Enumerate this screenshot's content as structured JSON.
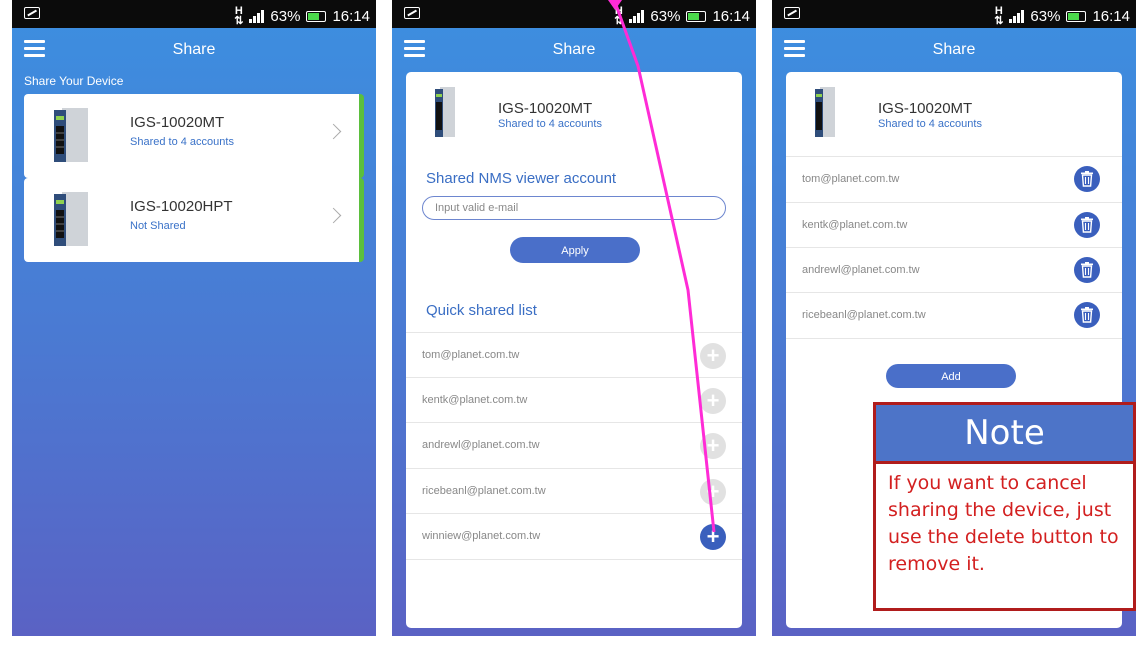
{
  "status_bar": {
    "battery_pct": "63%",
    "time": "16:14",
    "network": "H"
  },
  "screen1": {
    "title": "Share",
    "section_label": "Share Your Device",
    "devices": [
      {
        "name": "IGS-10020MT",
        "status": "Shared to 4 accounts"
      },
      {
        "name": "IGS-10020HPT",
        "status": "Not Shared"
      }
    ]
  },
  "screen2": {
    "title": "Share",
    "device": {
      "name": "IGS-10020MT",
      "status": "Shared to 4 accounts"
    },
    "viewer_heading": "Shared NMS viewer account",
    "email_placeholder": "Input valid e-mail",
    "apply_label": "Apply",
    "quick_heading": "Quick shared list",
    "quick_list": [
      {
        "email": "tom@planet.com.tw",
        "active": false
      },
      {
        "email": "kentk@planet.com.tw",
        "active": false
      },
      {
        "email": "andrewl@planet.com.tw",
        "active": false
      },
      {
        "email": "ricebeanl@planet.com.tw",
        "active": false
      },
      {
        "email": "winniew@planet.com.tw",
        "active": true
      }
    ],
    "plus_glyph": "+"
  },
  "screen3": {
    "title": "Share",
    "device": {
      "name": "IGS-10020MT",
      "status": "Shared to 4 accounts"
    },
    "shared_accounts": [
      "tom@planet.com.tw",
      "kentk@planet.com.tw",
      "andrewl@planet.com.tw",
      "ricebeanl@planet.com.tw"
    ],
    "add_label": "Add"
  },
  "note": {
    "title": "Note",
    "lines": [
      "If you want  to cancel",
      "sharing the device,  just",
      "use the delete button to",
      "remove  it."
    ]
  },
  "colors": {
    "accent": "#4a6fc9",
    "device_accent": "#5bbf3d",
    "annotation": "#ff2bd6",
    "note_border": "#b01c1c",
    "note_text": "#d32020"
  }
}
